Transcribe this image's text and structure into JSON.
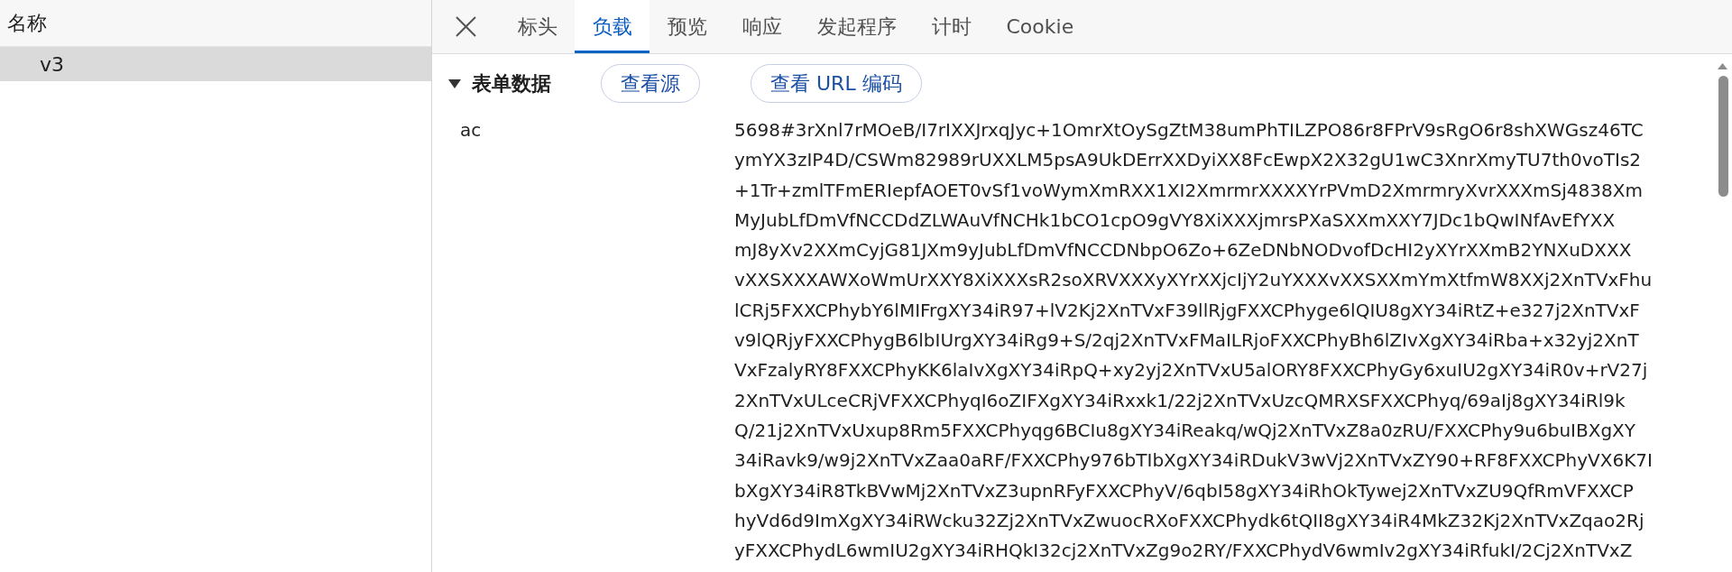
{
  "request_list": {
    "column_header": "名称",
    "rows": [
      {
        "name": "v3",
        "selected": true
      }
    ]
  },
  "detail_tabs": [
    {
      "label": "标头",
      "selected": false
    },
    {
      "label": "负载",
      "selected": true
    },
    {
      "label": "预览",
      "selected": false
    },
    {
      "label": "响应",
      "selected": false
    },
    {
      "label": "发起程序",
      "selected": false
    },
    {
      "label": "计时",
      "selected": false
    },
    {
      "label": "Cookie",
      "selected": false
    }
  ],
  "payload": {
    "sections": [
      {
        "title": "表单数据",
        "expanded": true,
        "buttons": [
          "查看源",
          "查看 URL 编码"
        ],
        "fields": [
          {
            "name": "ac",
            "value_lines": [
              "5698#3rXnl7rMOeB/I7rIXXJrxqJyc+1OmrXtOySgZtM38umPhTILZPO86r8FPrV9sRgO6r8shXWGsz46TC",
              "ymYX3zIP4D/CSWm82989rUXXLM5psA9UkDErrXXDyiXX8FcEwpX2X32gU1wC3XnrXmyTU7th0voTIs2",
              "+1Tr+zmlTFmERIepfAOET0vSf1voWymXmRXX1XI2XmrmrXXXXYrPVmD2XmrmryXvrXXXmSj4838Xm",
              "MyJubLfDmVfNCCDdZLWAuVfNCHk1bCO1cpO9gVY8XiXXXjmrsPXaSXXmXXY7JDc1bQwINfAvEfYXX",
              "mJ8yXv2XXmCyjG81JXm9yJubLfDmVfNCCDNbpO6Zo+6ZeDNbNODvofDcHI2yXYrXXmB2YNXuDXXX",
              "vXXSXXXAWXoWmUrXXY8XiXXXsR2soXRVXXXyXYrXXjcIjY2uYXXXvXXSXXmYmXtfmW8XXj2XnTVxFhu",
              "lCRj5FXXCPhybY6lMIFrgXY34iR97+lV2Kj2XnTVxF39llRjgFXXCPhyge6lQIU8gXY34iRtZ+e327j2XnTVxF",
              "v9lQRjyFXXCPhygB6lbIUrgXY34iRg9+S/2qj2XnTVxFMaILRjoFXXCPhyBh6lZIvXgXY34iRba+x32yj2XnT",
              "VxFzalyRY8FXXCPhyKK6laIvXgXY34iRpQ+xy2yj2XnTVxU5alORY8FXXCPhyGy6xuIU2gXY34iR0v+rV27j",
              "2XnTVxULceCRjVFXXCPhyqI6oZIFXgXY34iRxxk1/22j2XnTVxUzcQMRXSFXXCPhyq/69aIj8gXY34iRl9k",
              "Q/21j2XnTVxUxup8Rm5FXXCPhyqg6BCIu8gXY34iReakq/wQj2XnTVxZ8a0zRU/FXXCPhy9u6buIBXgXY",
              "34iRavk9/w9j2XnTVxZaa0aRF/FXXCPhy976bTIbXgXY34iRDukV3wVj2XnTVxZY90+RF8FXXCPhyVX6K7I",
              "bXgXY34iR8TkBVwMj2XnTVxZ3upnRFyFXXCPhyV/6qbI58gXY34iRhOkTywej2XnTVxZU9QfRmVFXXCP",
              "hyVd6d9ImXgXY34iRWcku32Zj2XnTVxZwuocRXoFXXCPhydk6tQII8gXY34iR4MkZ32Kj2XnTVxZqao2Rj",
              "yFXXCPhydL6wmIU2gXY34iRHQkI32cj2XnTVxZg9o2RY/FXXCPhydV6wmIv2gXY34iRfukI/2Cj2XnTVxZ"
            ]
          }
        ]
      }
    ]
  }
}
